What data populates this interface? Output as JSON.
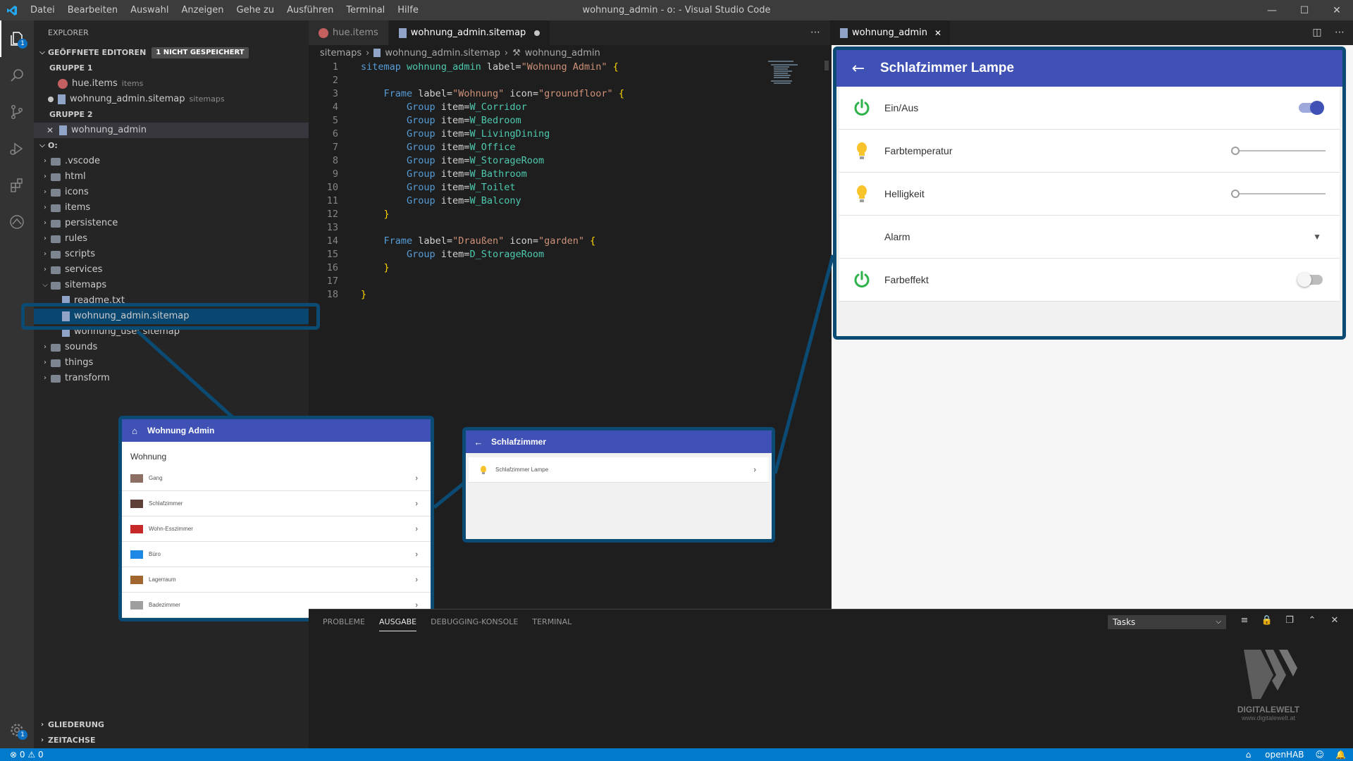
{
  "titlebar": {
    "menu": [
      "Datei",
      "Bearbeiten",
      "Auswahl",
      "Anzeigen",
      "Gehe zu",
      "Ausführen",
      "Terminal",
      "Hilfe"
    ],
    "title": "wohnung_admin - o: - Visual Studio Code"
  },
  "activity": {
    "explorer_badge": "1",
    "settings_badge": "1"
  },
  "sidebar": {
    "title": "EXPLORER",
    "open_editors": {
      "label": "GEÖFFNETE EDITOREN",
      "pill": "1 NICHT GESPEICHERT"
    },
    "group1": {
      "label": "GRUPPE 1",
      "files": [
        {
          "name": "hue.items",
          "desc": "items"
        },
        {
          "name": "wohnung_admin.sitemap",
          "desc": "sitemaps"
        }
      ]
    },
    "group2": {
      "label": "GRUPPE 2",
      "files": [
        {
          "name": "wohnung_admin"
        }
      ]
    },
    "root": "O:",
    "tree": [
      ".vscode",
      "html",
      "icons",
      "items",
      "persistence",
      "rules",
      "scripts",
      "services",
      "sitemaps"
    ],
    "sitemaps_children": [
      "readme.txt",
      "wohnung_admin.sitemap",
      "wohnung_user.sitemap"
    ],
    "tree_after": [
      "sounds",
      "things",
      "transform"
    ],
    "bottom_sections": [
      "GLIEDERUNG",
      "ZEITACHSE"
    ]
  },
  "editor": {
    "tabs": [
      {
        "label": "hue.items"
      },
      {
        "label": "wohnung_admin.sitemap"
      }
    ],
    "breadcrumb": [
      "sitemaps",
      "wohnung_admin.sitemap",
      "wohnung_admin"
    ],
    "code": [
      [
        [
          "kw",
          "sitemap"
        ],
        [
          "plain",
          " "
        ],
        [
          "ident",
          "wohnung_admin"
        ],
        [
          "plain",
          " label="
        ],
        [
          "str",
          "\"Wohnung Admin\""
        ],
        [
          "plain",
          " "
        ],
        [
          "brace",
          "{"
        ]
      ],
      [],
      [
        [
          "plain",
          "    "
        ],
        [
          "kw",
          "Frame"
        ],
        [
          "plain",
          " label="
        ],
        [
          "str",
          "\"Wohnung\""
        ],
        [
          "plain",
          " icon="
        ],
        [
          "str",
          "\"groundfloor\""
        ],
        [
          "plain",
          " "
        ],
        [
          "brace",
          "{"
        ]
      ],
      [
        [
          "plain",
          "        "
        ],
        [
          "kw",
          "Group"
        ],
        [
          "plain",
          " item="
        ],
        [
          "ident",
          "W_Corridor"
        ]
      ],
      [
        [
          "plain",
          "        "
        ],
        [
          "kw",
          "Group"
        ],
        [
          "plain",
          " item="
        ],
        [
          "ident",
          "W_Bedroom"
        ]
      ],
      [
        [
          "plain",
          "        "
        ],
        [
          "kw",
          "Group"
        ],
        [
          "plain",
          " item="
        ],
        [
          "ident",
          "W_LivingDining"
        ]
      ],
      [
        [
          "plain",
          "        "
        ],
        [
          "kw",
          "Group"
        ],
        [
          "plain",
          " item="
        ],
        [
          "ident",
          "W_Office"
        ]
      ],
      [
        [
          "plain",
          "        "
        ],
        [
          "kw",
          "Group"
        ],
        [
          "plain",
          " item="
        ],
        [
          "ident",
          "W_StorageRoom"
        ]
      ],
      [
        [
          "plain",
          "        "
        ],
        [
          "kw",
          "Group"
        ],
        [
          "plain",
          " item="
        ],
        [
          "ident",
          "W_Bathroom"
        ]
      ],
      [
        [
          "plain",
          "        "
        ],
        [
          "kw",
          "Group"
        ],
        [
          "plain",
          " item="
        ],
        [
          "ident",
          "W_Toilet"
        ]
      ],
      [
        [
          "plain",
          "        "
        ],
        [
          "kw",
          "Group"
        ],
        [
          "plain",
          " item="
        ],
        [
          "ident",
          "W_Balcony"
        ]
      ],
      [
        [
          "plain",
          "    "
        ],
        [
          "brace",
          "}"
        ]
      ],
      [],
      [
        [
          "plain",
          "    "
        ],
        [
          "kw",
          "Frame"
        ],
        [
          "plain",
          " label="
        ],
        [
          "str",
          "\"Draußen\""
        ],
        [
          "plain",
          " icon="
        ],
        [
          "str",
          "\"garden\""
        ],
        [
          "plain",
          " "
        ],
        [
          "brace",
          "{"
        ]
      ],
      [
        [
          "plain",
          "        "
        ],
        [
          "kw",
          "Group"
        ],
        [
          "plain",
          " item="
        ],
        [
          "ident",
          "D_StorageRoom"
        ]
      ],
      [
        [
          "plain",
          "    "
        ],
        [
          "brace",
          "}"
        ]
      ],
      [],
      [
        [
          "brace",
          "}"
        ]
      ]
    ]
  },
  "preview": {
    "tab": "wohnung_admin",
    "title": "Schlafzimmer Lampe",
    "rows": [
      {
        "label": "Ein/Aus",
        "type": "switch",
        "on": true
      },
      {
        "label": "Farbtemperatur",
        "type": "slider",
        "value": 0
      },
      {
        "label": "Helligkeit",
        "type": "slider",
        "value": 0
      },
      {
        "label": "Alarm",
        "type": "select"
      },
      {
        "label": "Farbeffekt",
        "type": "switch",
        "on": false
      }
    ],
    "accent": "#3f51b5"
  },
  "callout_left": {
    "title": "Wohnung Admin",
    "section": "Wohnung",
    "rows": [
      "Gang",
      "Schlafzimmer",
      "Wohn-Esszimmer",
      "Büro",
      "Lagerraum",
      "Badezimmer"
    ]
  },
  "callout_mid": {
    "title": "Schlafzimmer",
    "rows": [
      "Schlafzimmer Lampe"
    ]
  },
  "panel": {
    "tabs": [
      "PROBLEME",
      "AUSGABE",
      "DEBUGGING-KONSOLE",
      "TERMINAL"
    ],
    "active_tab": "AUSGABE",
    "select": "Tasks"
  },
  "logo": {
    "name": "DIGITALEWELT",
    "url": "www.digitalewelt.at"
  },
  "status": {
    "errors": "0",
    "warnings": "0",
    "openhab": "openHAB"
  }
}
